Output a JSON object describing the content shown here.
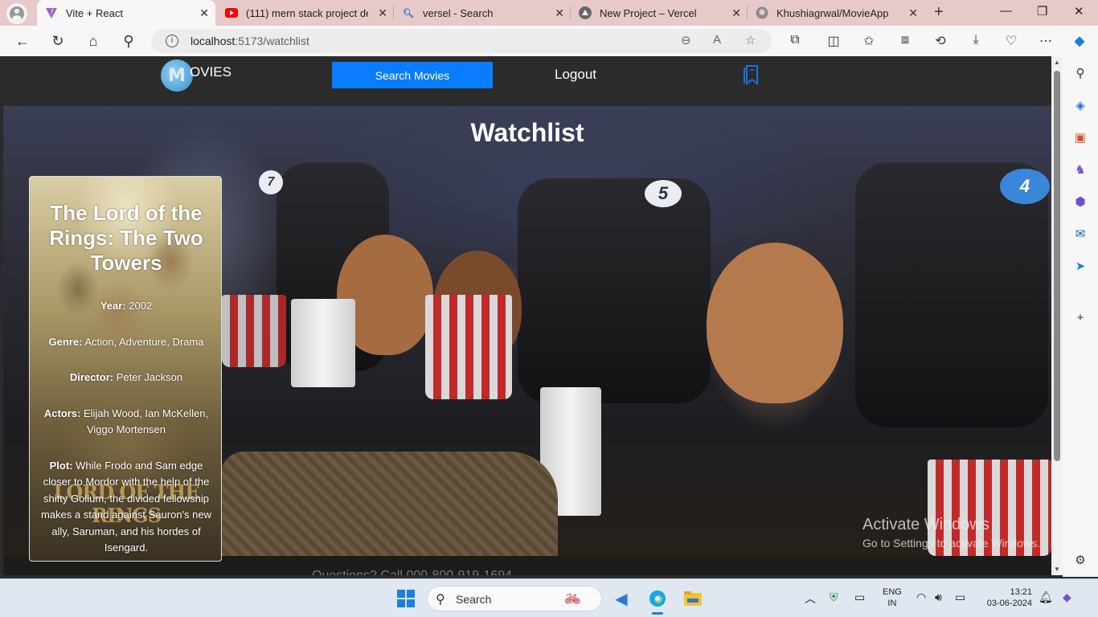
{
  "browser": {
    "tabs": [
      {
        "title": "Vite + React",
        "icon": "vite-icon",
        "active": true
      },
      {
        "title": "(111) mern stack project depl",
        "icon": "youtube-icon"
      },
      {
        "title": "versel - Search",
        "icon": "search-icon"
      },
      {
        "title": "New Project – Vercel",
        "icon": "vercel-icon"
      },
      {
        "title": "Khushiagrwal/MovieApp",
        "icon": "github-icon"
      }
    ],
    "url_host": "localhost",
    "url_path": ":5173/watchlist"
  },
  "site": {
    "logo_letter": "M",
    "logo_text": "OVIES",
    "search_button": "Search Movies",
    "logout": "Logout",
    "page_title": "Watchlist"
  },
  "movie": {
    "title": "The Lord of the Rings: The Two Towers",
    "year_label": "Year:",
    "year": "2002",
    "genre_label": "Genre:",
    "genre": "Action, Adventure, Drama",
    "director_label": "Director:",
    "director": "Peter Jackson",
    "actors_label": "Actors:",
    "actors": "Elijah Wood, Ian McKellen, Viggo Mortensen",
    "plot_label": "Plot:",
    "plot": "While Frodo and Sam edge closer to Mordor with the help of the shifty Gollum, the divided fellowship makes a stand against Sauron's new ally, Saruman, and his hordes of Isengard.",
    "poster_logo": "LORD OF THE RINGS"
  },
  "footer_peek": "Questions? Call 000-800-919-1694",
  "watermark": {
    "line1": "Activate Windows",
    "line2": "Go to Settings to activate Windows."
  },
  "taskbar": {
    "search_label": "Search",
    "lang1": "ENG",
    "lang2": "IN",
    "time": "13:21",
    "date": "03-06-2024"
  }
}
